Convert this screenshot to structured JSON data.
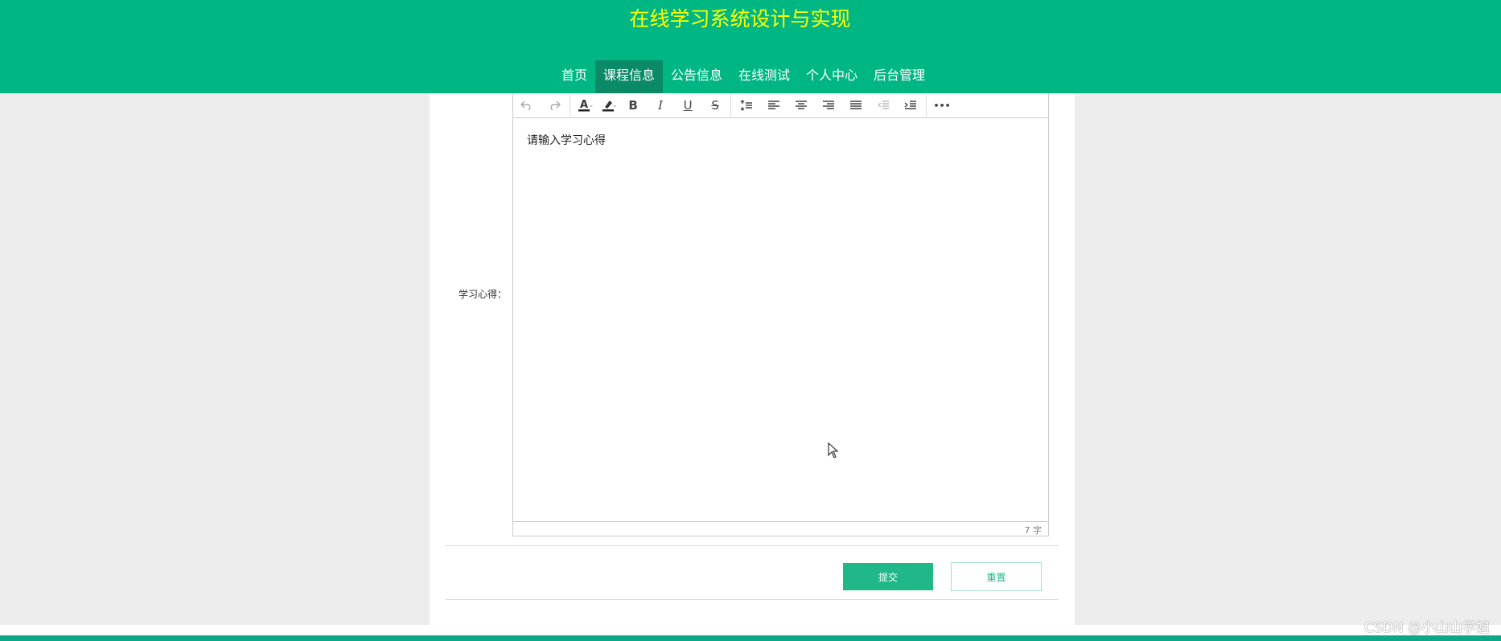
{
  "header": {
    "title": "在线学习系统设计与实现"
  },
  "nav": {
    "items": [
      {
        "label": "首页"
      },
      {
        "label": "课程信息"
      },
      {
        "label": "公告信息"
      },
      {
        "label": "在线测试"
      },
      {
        "label": "个人中心"
      },
      {
        "label": "后台管理"
      }
    ],
    "active_index": 1
  },
  "form": {
    "field_label": "学习心得：",
    "editor": {
      "placeholder": "请输入学习心得",
      "word_count": "7 字",
      "toolbar_icons": [
        "undo-icon",
        "redo-icon",
        "font-color-icon",
        "highlight-icon",
        "bold-icon",
        "italic-icon",
        "underline-icon",
        "strikethrough-icon",
        "line-height-icon",
        "align-left-icon",
        "align-center-icon",
        "align-right-icon",
        "justify-icon",
        "outdent-icon",
        "indent-icon",
        "more-icon"
      ],
      "toolbar_glyphs": {
        "bold": "B",
        "italic": "I",
        "underline": "U",
        "strike": "S",
        "more": "•••",
        "font_color": "A"
      }
    },
    "submit_label": "提交",
    "reset_label": "重置"
  },
  "watermark": "CSDN @小山山学姐",
  "colors": {
    "header_bg": "#00b784",
    "title": "#ffff00",
    "nav_active_bg": "#0a8a66",
    "accent": "#20b888",
    "page_bg": "#ededed"
  }
}
